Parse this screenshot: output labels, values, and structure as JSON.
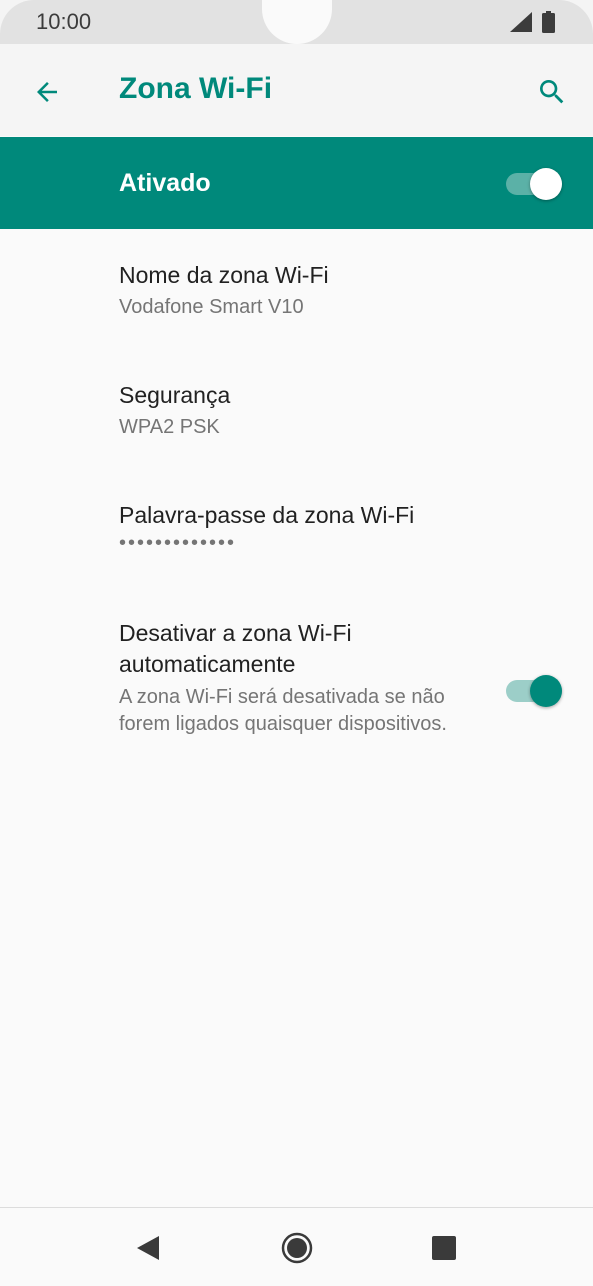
{
  "status_bar": {
    "time": "10:00"
  },
  "app_bar": {
    "title": "Zona Wi-Fi",
    "back_icon": "arrow-back-icon",
    "search_icon": "search-icon"
  },
  "master_switch": {
    "label": "Ativado",
    "checked": true
  },
  "settings": {
    "hotspot_name": {
      "title": "Nome da zona Wi-Fi",
      "value": "Vodafone Smart V10"
    },
    "security": {
      "title": "Segurança",
      "value": "WPA2 PSK"
    },
    "password": {
      "title": "Palavra-passe da zona Wi-Fi",
      "value": "•••••••••••••"
    },
    "auto_off": {
      "title": "Desativar a zona Wi-Fi automaticamente",
      "summary": "A zona Wi-Fi será desativada se não forem ligados quaisquer dispositivos.",
      "checked": true
    }
  },
  "colors": {
    "accent": "#00897b",
    "status_bar": "#e2e2e2",
    "background": "#fafafa"
  }
}
